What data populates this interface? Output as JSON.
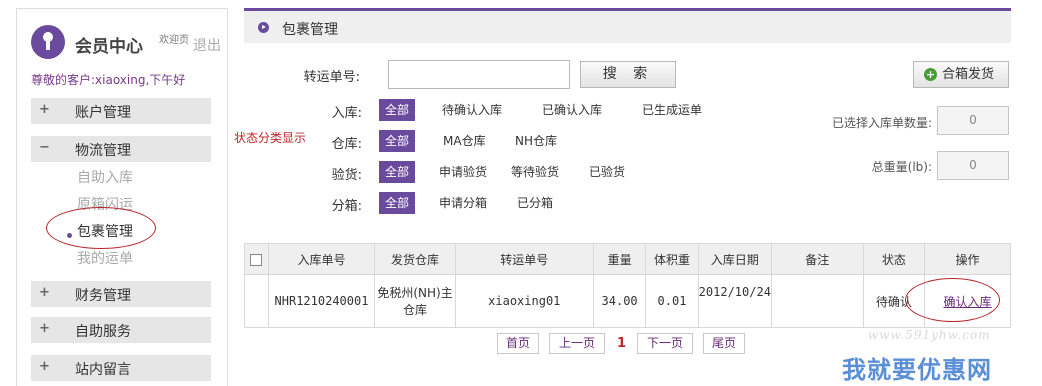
{
  "sidebar": {
    "title": "会员中心",
    "welcome": "欢迎页",
    "logout": "退出",
    "greeting": "尊敬的客户:xiaoxing,下午好",
    "menus": [
      {
        "sign": "+",
        "label": "账户管理"
      },
      {
        "sign": "−",
        "label": "物流管理"
      },
      {
        "sign": "+",
        "label": "财务管理"
      },
      {
        "sign": "+",
        "label": "自助服务"
      },
      {
        "sign": "+",
        "label": "站内留言"
      }
    ],
    "sub_items": [
      "自助入库",
      "原箱闪运",
      "包裹管理",
      "我的运单"
    ]
  },
  "section": {
    "title": "包裹管理"
  },
  "filters": {
    "tracking_label": "转运单号:",
    "tracking_value": "",
    "search_label": "搜 索",
    "merge_label": "合箱发货",
    "status_note": "状态分类显示",
    "inbound": {
      "label": "入库:",
      "options": [
        "全部",
        "待确认入库",
        "已确认入库",
        "已生成运单"
      ]
    },
    "warehouse": {
      "label": "仓库:",
      "options": [
        "全部",
        "MA仓库",
        "NH仓库"
      ]
    },
    "inspection": {
      "label": "验货:",
      "options": [
        "全部",
        "申请验货",
        "等待验货",
        "已验货"
      ]
    },
    "split": {
      "label": "分箱:",
      "options": [
        "全部",
        "申请分箱",
        "已分箱"
      ]
    },
    "selected_count_label": "已选择入库单数量:",
    "selected_count_value": "0",
    "total_weight_label": "总重量(lb):",
    "total_weight_value": "0"
  },
  "table": {
    "headers": [
      "入库单号",
      "发货仓库",
      "转运单号",
      "重量",
      "体积重",
      "入库日期",
      "备注",
      "状态",
      "操作"
    ],
    "rows": [
      {
        "inbound_no": "NHR1210240001",
        "warehouse": "免税州(NH)主仓库",
        "tracking_no": "xiaoxing01",
        "weight": "34.00",
        "vol_weight": "0.01",
        "date": "2012/10/24",
        "remark": "",
        "status": "待确认",
        "action": "确认入库"
      }
    ]
  },
  "pager": {
    "first": "首页",
    "prev": "上一页",
    "current": "1",
    "next": "下一页",
    "last": "尾页"
  },
  "watermark": {
    "url": "www.591yhw.com",
    "text": "我就要优惠网"
  },
  "colors": {
    "accent": "#6a4a9c",
    "annotation": "#c0262a"
  }
}
